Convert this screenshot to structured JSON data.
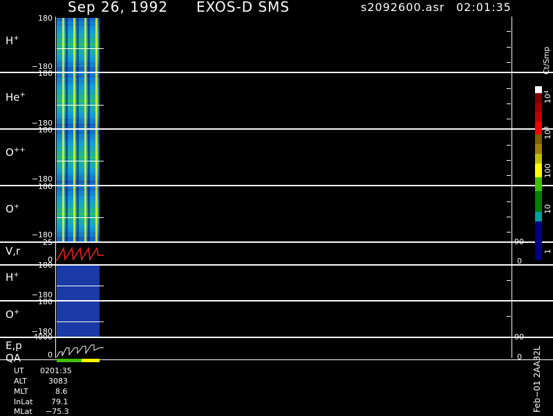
{
  "header": {
    "date": "Sep 26, 1992",
    "instrument": "EXOS-D SMS",
    "file": "s2092600.asr",
    "time": "02:01:35"
  },
  "panels": {
    "h_plus": {
      "species": "H",
      "charge": "+",
      "ytop": "180",
      "ybot": "−180"
    },
    "he_plus": {
      "species": "He",
      "charge": "+",
      "ytop": "180",
      "ybot": "−180"
    },
    "o_plusplus": {
      "species": "O",
      "charge": "++",
      "ytop": "180",
      "ybot": "−180"
    },
    "o_plus": {
      "species": "O",
      "charge": "+",
      "ytop": "180",
      "ybot": "−180"
    },
    "vr": {
      "label": "V,r",
      "ytop": "25",
      "ybot": "0",
      "rtop": "90",
      "rbot": "0"
    },
    "h_plus2": {
      "species": "H",
      "charge": "+",
      "ytop": "180",
      "ybot": "−180"
    },
    "o_plus2": {
      "species": "O",
      "charge": "+",
      "ytop": "180",
      "ybot": "−180"
    },
    "ep": {
      "label1": "E,p",
      "label2": "QA",
      "ytop": "4000",
      "ybot": "0",
      "rtop": "90",
      "rbot": "0"
    }
  },
  "colorbar": {
    "unit": "Ct/Smp",
    "labels": [
      "10",
      "4",
      "10",
      "3",
      "100",
      "10",
      "1"
    ],
    "colors": [
      "#ffffff",
      "#800000",
      "#a00000",
      "#c00000",
      "#ff0000",
      "#806000",
      "#a08000",
      "#c0c000",
      "#ffff00",
      "#40c000",
      "#008000",
      "#00a0a0",
      "#000080"
    ]
  },
  "info": {
    "ut_label": "UT",
    "ut_value": "0201:35",
    "alt_label": "ALT",
    "alt_value": "3083",
    "mlt_label": "MLT",
    "mlt_value": "8.6",
    "inlat_label": "InLat",
    "inlat_value": "79.1",
    "mlat_label": "MLat",
    "mlat_value": "−75.3"
  },
  "footer_tag": "Feb−01  2AA32L"
}
